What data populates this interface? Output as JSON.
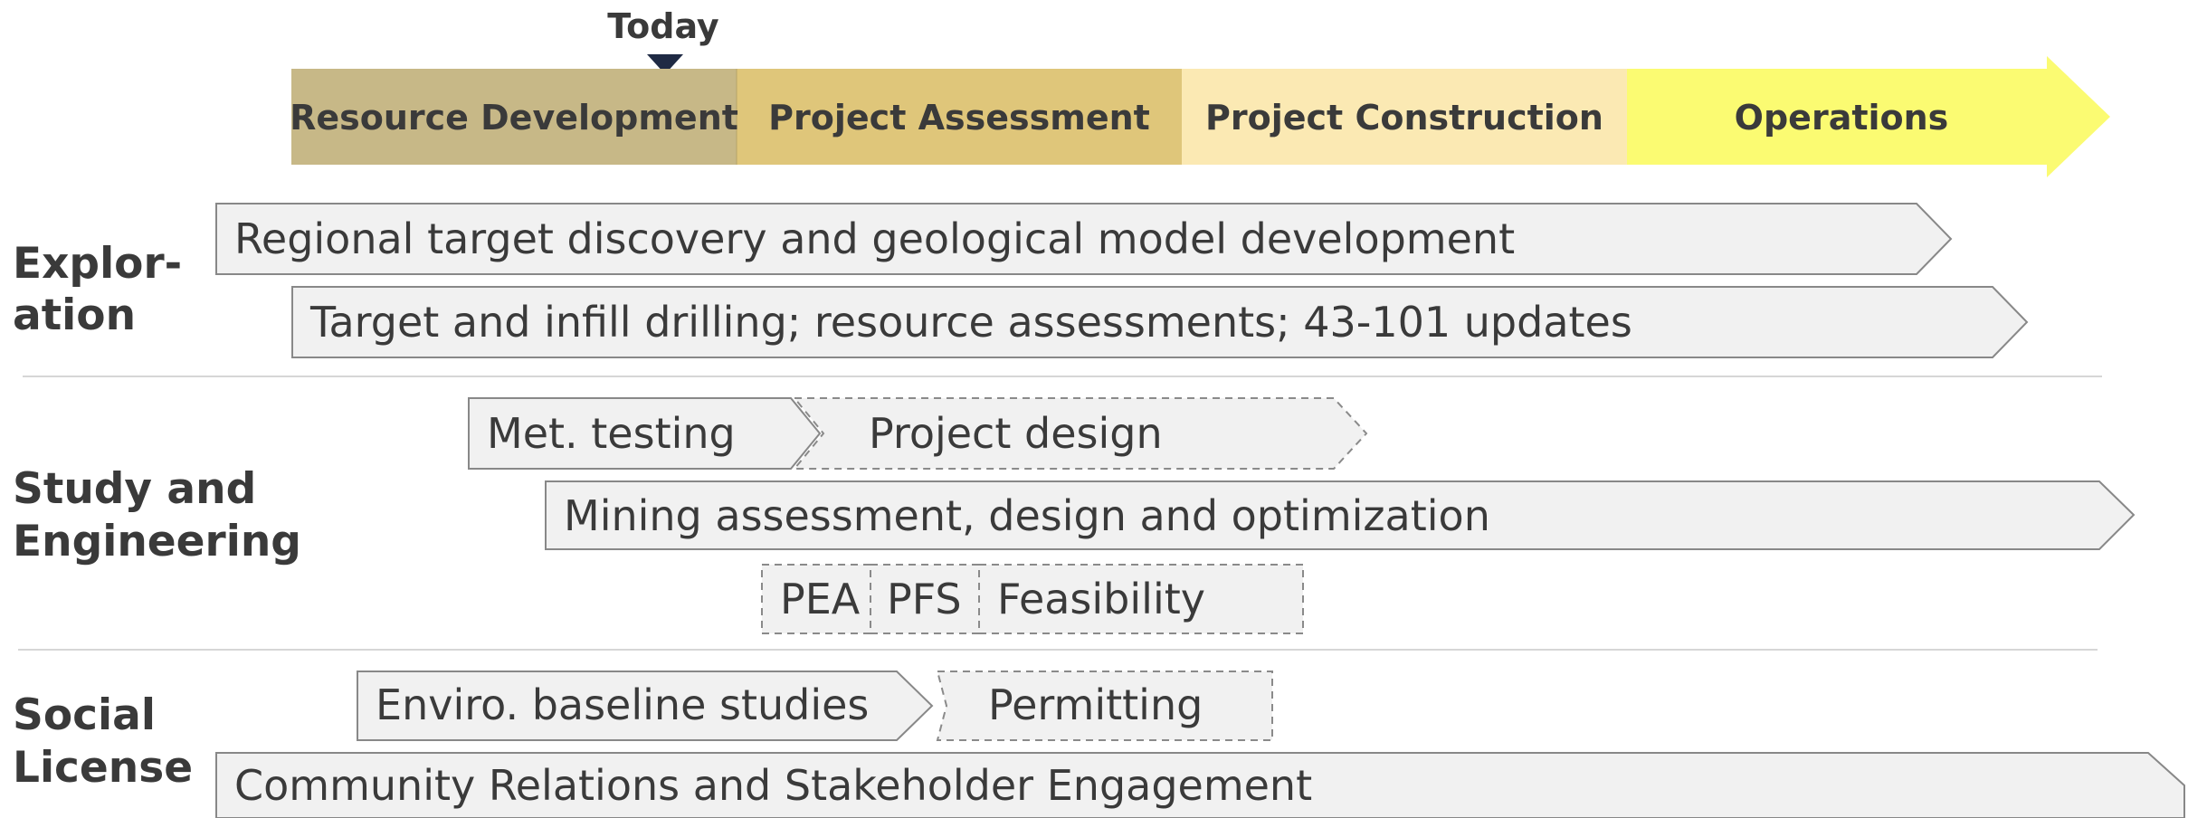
{
  "today_label": "Today",
  "phases": [
    {
      "label": "Resource Development",
      "color": "#c7b887"
    },
    {
      "label": "Project Assessment",
      "color": "#dfc67a"
    },
    {
      "label": "Project Construction",
      "color": "#fbe9b3"
    },
    {
      "label": "Operations",
      "color": "#fbfb72"
    }
  ],
  "rows": [
    {
      "label_line1": "Explor-",
      "label_line2": "ation"
    },
    {
      "label_line1": "Study and",
      "label_line2": "Engineering"
    },
    {
      "label_line1": "Social",
      "label_line2": "License"
    }
  ],
  "tasks": {
    "regional": "Regional target discovery and geological model development",
    "target": "Target and infill drilling; resource assessments; 43-101 updates",
    "met_testing": "Met. testing",
    "project_design": "Project design",
    "mining": "Mining assessment, design and optimization",
    "pea": "PEA",
    "pfs": "PFS",
    "feasibility": "Feasibility",
    "enviro": "Enviro. baseline studies",
    "permitting": "Permitting",
    "community": "Community Relations and Stakeholder Engagement"
  },
  "colors": {
    "bar_fill": "#f1f1f1",
    "bar_stroke": "#888888",
    "marker": "#1f2a44",
    "text": "#3a3a3a"
  }
}
